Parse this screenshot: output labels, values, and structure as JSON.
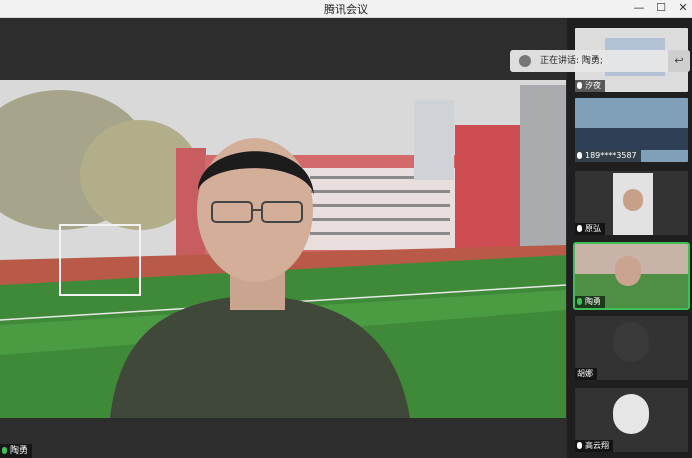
{
  "window": {
    "title": "腾讯会议",
    "controls": {
      "minimize": "—",
      "maximize": "☐",
      "close": "✕"
    }
  },
  "main_video": {
    "speaker_name": "陶勇"
  },
  "speaking_banner": {
    "text": "正在讲话: 陶勇;"
  },
  "participants": [
    {
      "name": "汐夜"
    },
    {
      "name": "189****3587"
    },
    {
      "name": "原弘"
    },
    {
      "name": "陶勇"
    },
    {
      "name": "胡娜"
    },
    {
      "name": "高云翔"
    }
  ],
  "colors": {
    "active_border": "#3fbf5a"
  }
}
